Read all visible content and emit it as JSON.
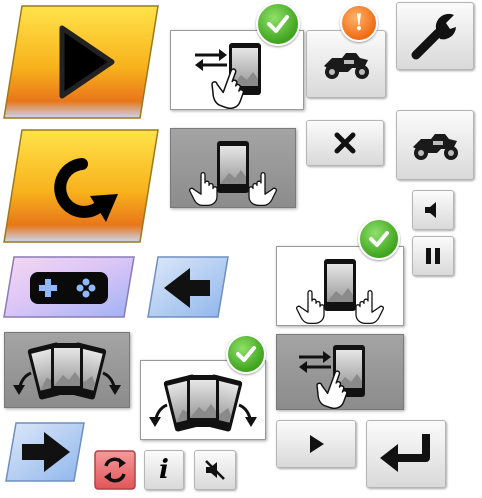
{
  "sprites": [
    {
      "name": "play-button-large",
      "icon": "play-icon",
      "style": "orange-parallelogram"
    },
    {
      "name": "restart-button-large",
      "icon": "restart-icon",
      "style": "orange-parallelogram"
    },
    {
      "name": "gamepad-button",
      "icon": "gamepad-icon",
      "style": "purple-parallelogram"
    },
    {
      "name": "back-arrow-button",
      "icon": "arrow-left-icon",
      "style": "blue-parallelogram"
    },
    {
      "name": "forward-arrow-button",
      "icon": "arrow-right-icon",
      "style": "blue-parallelogram"
    },
    {
      "name": "tilt-control-panel",
      "icon": "tilt-phone-icon",
      "style": "dark-panel"
    },
    {
      "name": "tilt-control-panel-selected",
      "icon": "tilt-phone-icon",
      "style": "light-panel",
      "badge": "check"
    },
    {
      "name": "swipe-control-panel-selected",
      "icon": "swipe-phone-icon",
      "style": "light-panel",
      "badge": "check"
    },
    {
      "name": "two-hand-control-panel",
      "icon": "two-hand-phone-icon",
      "style": "dark-panel"
    },
    {
      "name": "two-hand-control-panel-selected",
      "icon": "two-hand-phone-icon",
      "style": "light-panel",
      "badge": "check"
    },
    {
      "name": "swipe-control-panel",
      "icon": "swipe-phone-icon",
      "style": "dark-panel"
    },
    {
      "name": "motorbike-alert-button",
      "icon": "motorbike-icon",
      "badge": "exclamation"
    },
    {
      "name": "wrench-settings-button",
      "icon": "wrench-icon"
    },
    {
      "name": "close-button",
      "icon": "close-icon"
    },
    {
      "name": "motorbike-button",
      "icon": "motorbike-icon"
    },
    {
      "name": "sound-on-button",
      "icon": "speaker-icon"
    },
    {
      "name": "pause-button",
      "icon": "pause-icon"
    },
    {
      "name": "play-button-small",
      "icon": "play-icon"
    },
    {
      "name": "enter-button",
      "icon": "enter-arrow-icon"
    },
    {
      "name": "refresh-button",
      "icon": "refresh-icon",
      "style": "red"
    },
    {
      "name": "info-button",
      "icon": "info-icon"
    },
    {
      "name": "sound-off-button",
      "icon": "speaker-mute-icon"
    }
  ],
  "glyphs": {
    "info": "i",
    "exclamation": "!"
  },
  "colors": {
    "orange_top": "#ffd21a",
    "orange_bottom": "#e86a0e",
    "purple_top": "#f4d9f4",
    "purple_bottom": "#c4b2ff",
    "blue_top": "#c9dcf6",
    "blue_bottom": "#9cc0ee",
    "check_green": "#3fa41e",
    "warn_orange": "#f06b12",
    "refresh_red": "#e8696b",
    "icon_dark": "#1a1a1a"
  }
}
